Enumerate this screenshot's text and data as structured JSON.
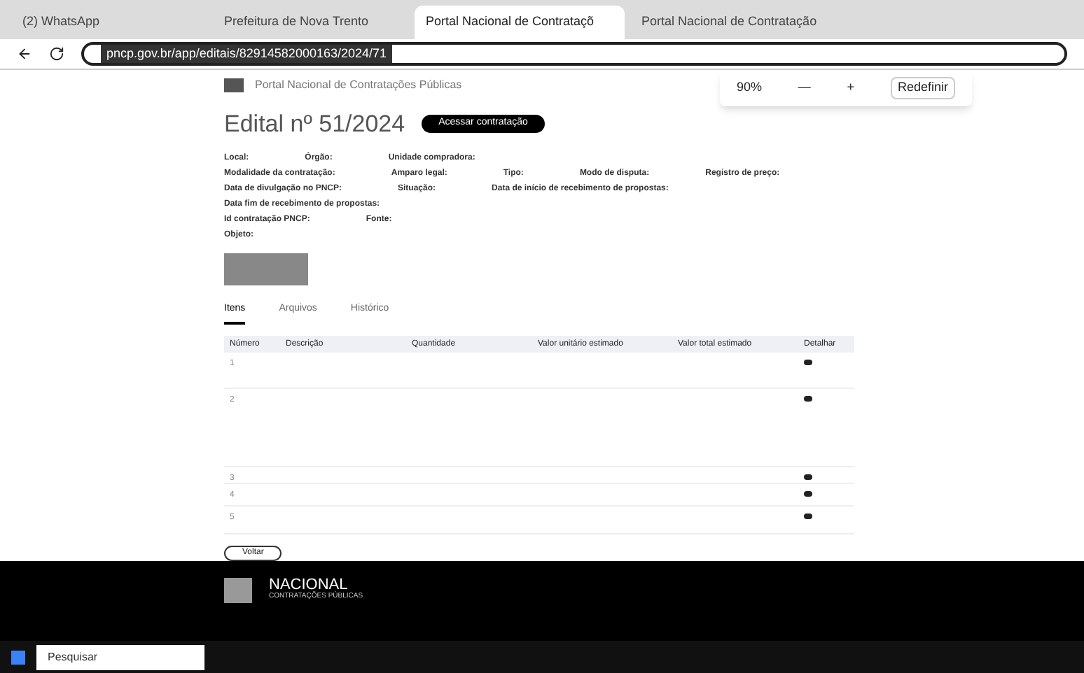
{
  "browser": {
    "tabs": [
      {
        "title": "(2) WhatsApp",
        "selected": false
      },
      {
        "title": "Prefeitura de Nova Trento",
        "selected": false
      },
      {
        "title": "Portal Nacional de Contrataçõ",
        "selected": true
      },
      {
        "title": "Portal Nacional de Contratação",
        "selected": false
      }
    ],
    "url": "pncp.gov.br/app/editais/82914582000163/2024/71"
  },
  "zoom_popup": {
    "value": "90%",
    "minus": "—",
    "plus": "+",
    "reset": "Redefinir"
  },
  "header": {
    "site_name": "Portal Nacional de Contratações Públicas"
  },
  "page": {
    "title": "Edital nº 51/2024",
    "action": "Acessar contratação",
    "fields": [
      [
        "Local:",
        "Órgão:",
        "Unidade compradora:"
      ],
      [
        "Modalidade da contratação:",
        "Amparo legal:",
        "Tipo:",
        "Modo de disputa:",
        "Registro de preço:"
      ],
      [
        "Data de divulgação no PNCP:",
        "Situação:",
        "Data de início de recebimento de propostas:"
      ],
      [
        "Data fim de recebimento de propostas:"
      ],
      [
        "Id contratação PNCP:",
        "Fonte:"
      ],
      [
        "Objeto:"
      ]
    ],
    "tabs": [
      {
        "label": "Itens",
        "selected": true
      },
      {
        "label": "Arquivos",
        "selected": false
      },
      {
        "label": "Histórico",
        "selected": false
      }
    ],
    "columns": [
      "Número",
      "Descrição",
      "Quantidade",
      "Valor unitário estimado",
      "Valor total estimado",
      "Detalhar"
    ],
    "rows": [
      {
        "number": "1"
      },
      {
        "number": "2"
      },
      {
        "number": "3"
      },
      {
        "number": "4"
      },
      {
        "number": "5"
      }
    ],
    "back": "Voltar"
  },
  "footer": {
    "logo_top": "NACIONAL",
    "logo_bottom": "CONTRATAÇÕES PÚBLICAS"
  },
  "taskbar": {
    "search": "Pesquisar"
  }
}
